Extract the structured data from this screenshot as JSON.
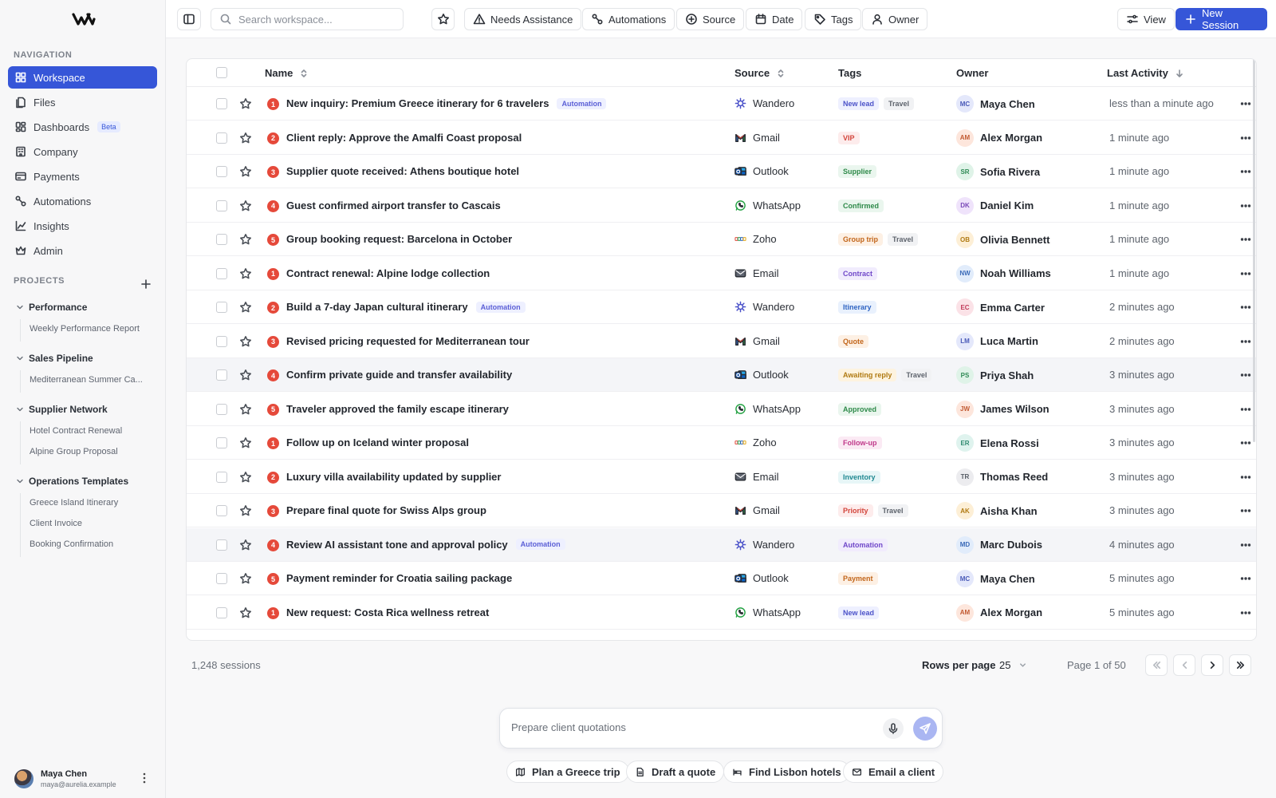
{
  "sidebar": {
    "navigation_label": "NAVIGATION",
    "nav": [
      {
        "label": "Workspace",
        "icon": "grid-icon",
        "active": true
      },
      {
        "label": "Files",
        "icon": "files-icon"
      },
      {
        "label": "Dashboards",
        "icon": "dashboard-icon",
        "badge": "Beta"
      },
      {
        "label": "Company",
        "icon": "building-icon"
      },
      {
        "label": "Payments",
        "icon": "card-icon"
      },
      {
        "label": "Automations",
        "icon": "automation-icon"
      },
      {
        "label": "Insights",
        "icon": "chart-icon"
      },
      {
        "label": "Admin",
        "icon": "crown-icon"
      }
    ],
    "projects_label": "PROJECTS",
    "projects": [
      {
        "title": "Performance",
        "items": [
          "Weekly Performance Report"
        ]
      },
      {
        "title": "Sales Pipeline",
        "items": [
          "Mediterranean Summer Ca..."
        ]
      },
      {
        "title": "Supplier Network",
        "items": [
          "Hotel Contract Renewal",
          "Alpine Group Proposal"
        ]
      },
      {
        "title": "Operations Templates",
        "items": [
          "Greece Island Itinerary",
          "Client Invoice",
          "Booking Confirmation"
        ]
      }
    ],
    "user": {
      "name": "Maya Chen",
      "email": "maya@aurelia.example"
    }
  },
  "topbar": {
    "search_placeholder": "Search workspace...",
    "filters": [
      "Needs Assistance",
      "Automations",
      "Source",
      "Date",
      "Tags",
      "Owner"
    ],
    "view_label": "View",
    "new_session_label": "New Session"
  },
  "table": {
    "columns": {
      "name": "Name",
      "source": "Source",
      "tags": "Tags",
      "owner": "Owner",
      "activity": "Last Activity"
    },
    "rows": [
      {
        "priority": "1",
        "name": "New inquiry: Premium Greece itinerary for 6 travelers",
        "automation": "Automation",
        "source": "Wandero",
        "source_icon": "wandero-icon",
        "tags": [
          "New lead",
          "Travel"
        ],
        "owner_initials": "MC",
        "owner": "Maya Chen",
        "activity": "less than a minute ago"
      },
      {
        "priority": "2",
        "name": "Client reply: Approve the Amalfi Coast proposal",
        "source": "Gmail",
        "source_icon": "gmail-icon",
        "tags": [
          "VIP"
        ],
        "owner_initials": "AM",
        "owner": "Alex Morgan",
        "activity": "1 minute ago"
      },
      {
        "priority": "3",
        "name": "Supplier quote received: Athens boutique hotel",
        "source": "Outlook",
        "source_icon": "outlook-icon",
        "tags": [
          "Supplier"
        ],
        "owner_initials": "SR",
        "owner": "Sofia Rivera",
        "activity": "1 minute ago"
      },
      {
        "priority": "4",
        "name": "Guest confirmed airport transfer to Cascais",
        "source": "WhatsApp",
        "source_icon": "whatsapp-icon",
        "tags": [
          "Confirmed"
        ],
        "owner_initials": "DK",
        "owner": "Daniel Kim",
        "activity": "1 minute ago"
      },
      {
        "priority": "5",
        "name": "Group booking request: Barcelona in October",
        "source": "Zoho",
        "source_icon": "zoho-icon",
        "tags": [
          "Group trip",
          "Travel"
        ],
        "owner_initials": "OB",
        "owner": "Olivia Bennett",
        "activity": "1 minute ago"
      },
      {
        "priority": "1",
        "name": "Contract renewal: Alpine lodge collection",
        "source": "Email",
        "source_icon": "mail-icon",
        "tags": [
          "Contract"
        ],
        "owner_initials": "NW",
        "owner": "Noah Williams",
        "activity": "1 minute ago"
      },
      {
        "priority": "2",
        "name": "Build a 7-day Japan cultural itinerary",
        "automation": "Automation",
        "source": "Wandero",
        "source_icon": "wandero-icon",
        "tags": [
          "Itinerary"
        ],
        "owner_initials": "EC",
        "owner": "Emma Carter",
        "activity": "2 minutes ago"
      },
      {
        "priority": "3",
        "name": "Revised pricing requested for Mediterranean tour",
        "source": "Gmail",
        "source_icon": "gmail-icon",
        "tags": [
          "Quote"
        ],
        "owner_initials": "LM",
        "owner": "Luca Martin",
        "activity": "2 minutes ago"
      },
      {
        "priority": "4",
        "name": "Confirm private guide and transfer availability",
        "source": "Outlook",
        "source_icon": "outlook-icon",
        "tags": [
          "Awaiting reply",
          "Travel"
        ],
        "owner_initials": "PS",
        "owner": "Priya Shah",
        "activity": "3 minutes ago",
        "highlight": true
      },
      {
        "priority": "5",
        "name": "Traveler approved the family escape itinerary",
        "source": "WhatsApp",
        "source_icon": "whatsapp-icon",
        "tags": [
          "Approved"
        ],
        "owner_initials": "JW",
        "owner": "James Wilson",
        "activity": "3 minutes ago"
      },
      {
        "priority": "1",
        "name": "Follow up on Iceland winter proposal",
        "source": "Zoho",
        "source_icon": "zoho-icon",
        "tags": [
          "Follow-up"
        ],
        "owner_initials": "ER",
        "owner": "Elena Rossi",
        "activity": "3 minutes ago"
      },
      {
        "priority": "2",
        "name": "Luxury villa availability updated by supplier",
        "source": "Email",
        "source_icon": "mail-icon",
        "tags": [
          "Inventory"
        ],
        "owner_initials": "TR",
        "owner": "Thomas Reed",
        "activity": "3 minutes ago"
      },
      {
        "priority": "3",
        "name": "Prepare final quote for Swiss Alps group",
        "source": "Gmail",
        "source_icon": "gmail-icon",
        "tags": [
          "Priority",
          "Travel"
        ],
        "owner_initials": "AK",
        "owner": "Aisha Khan",
        "activity": "3 minutes ago"
      },
      {
        "priority": "4",
        "name": "Review AI assistant tone and approval policy",
        "automation": "Automation",
        "source": "Wandero",
        "source_icon": "wandero-icon",
        "tags": [
          "Automation"
        ],
        "owner_initials": "MD",
        "owner": "Marc Dubois",
        "activity": "4 minutes ago",
        "highlight": true
      },
      {
        "priority": "5",
        "name": "Payment reminder for Croatia sailing package",
        "source": "Outlook",
        "source_icon": "outlook-icon",
        "tags": [
          "Payment"
        ],
        "owner_initials": "MC",
        "owner": "Maya Chen",
        "activity": "5 minutes ago"
      },
      {
        "priority": "1",
        "name": "New request: Costa Rica wellness retreat",
        "source": "WhatsApp",
        "source_icon": "whatsapp-icon",
        "tags": [
          "New lead"
        ],
        "owner_initials": "AM",
        "owner": "Alex Morgan",
        "activity": "5 minutes ago"
      }
    ]
  },
  "tag_colors": {
    "New lead": [
      "#eef0ff",
      "#4b52c9"
    ],
    "Travel": [
      "#f1f2f4",
      "#5d636c"
    ],
    "VIP": [
      "#fdecec",
      "#d2453b"
    ],
    "Supplier": [
      "#eaf6ee",
      "#2f8a4a"
    ],
    "Confirmed": [
      "#eaf6ee",
      "#2f8a4a"
    ],
    "Group trip": [
      "#fdf0e4",
      "#c2661b"
    ],
    "Contract": [
      "#f1ecfd",
      "#7048c9"
    ],
    "Itinerary": [
      "#e9f1fd",
      "#2f64c2"
    ],
    "Quote": [
      "#fdf0e4",
      "#c2661b"
    ],
    "Awaiting reply": [
      "#fdf3df",
      "#b07a12"
    ],
    "Approved": [
      "#eaf6ee",
      "#2f8a4a"
    ],
    "Follow-up": [
      "#fbeaf4",
      "#c0398a"
    ],
    "Inventory": [
      "#e7f6f7",
      "#1f8891"
    ],
    "Priority": [
      "#fdecec",
      "#d2453b"
    ],
    "Automation": [
      "#f1ecfd",
      "#7048c9"
    ],
    "Payment": [
      "#fdf0e4",
      "#c2661b"
    ]
  },
  "owner_colors": {
    "MC": [
      "#e4e8fb",
      "#4a5ab8"
    ],
    "AM": [
      "#fde6dc",
      "#c25a32"
    ],
    "SR": [
      "#dff3e8",
      "#2f8a55"
    ],
    "DK": [
      "#efe3fb",
      "#7a4ab8"
    ],
    "OB": [
      "#fdefd6",
      "#b07a12"
    ],
    "NW": [
      "#e1ecfb",
      "#3a6ab8"
    ],
    "EC": [
      "#fbe2e7",
      "#c23a5a"
    ],
    "LM": [
      "#e4e8fb",
      "#4a5ab8"
    ],
    "PS": [
      "#dff3e8",
      "#2f8a55"
    ],
    "JW": [
      "#fde6dc",
      "#c25a32"
    ],
    "ER": [
      "#dff3ee",
      "#2f8a70"
    ],
    "TR": [
      "#ececef",
      "#555b64"
    ],
    "AK": [
      "#fdefd6",
      "#b07a12"
    ],
    "MD": [
      "#e1ecfb",
      "#3a6ab8"
    ]
  },
  "pagination": {
    "count": "1,248 sessions",
    "rows_per_page_label": "Rows per page",
    "rows_per_page": "25",
    "page_label": "Page 1 of 50"
  },
  "chat": {
    "placeholder": "Prepare client quotations",
    "suggestions": [
      {
        "label": "Plan a Greece trip",
        "icon": "map-icon"
      },
      {
        "label": "Draft a quote",
        "icon": "document-icon"
      },
      {
        "label": "Find Lisbon hotels",
        "icon": "hotel-icon"
      },
      {
        "label": "Email a client",
        "icon": "mail-icon"
      }
    ]
  },
  "colors": {
    "accent": "#3656d8",
    "priority": "#e5493a"
  }
}
